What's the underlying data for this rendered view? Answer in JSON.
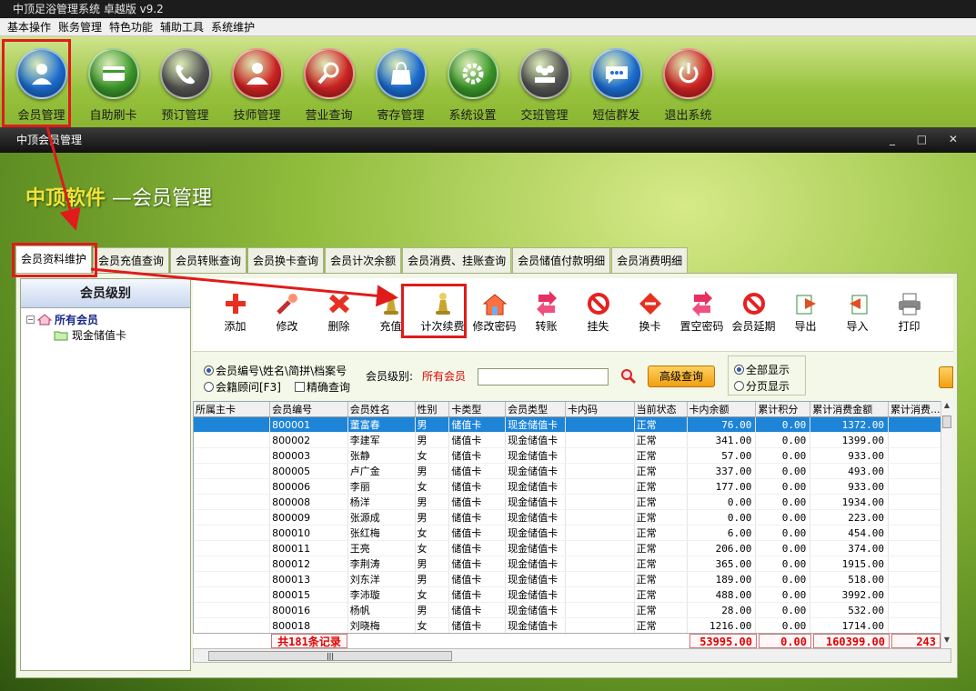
{
  "window": {
    "title": "中顶足浴管理系统 卓越版 v9.2"
  },
  "menu": [
    "基本操作",
    "账务管理",
    "特色功能",
    "辅助工具",
    "系统维护"
  ],
  "toolbar": [
    {
      "label": "会员管理",
      "icon": "user-icon",
      "color": "#1d6fd6"
    },
    {
      "label": "自助刷卡",
      "icon": "card-icon",
      "color": "#3c9a2b"
    },
    {
      "label": "预订管理",
      "icon": "phone-icon",
      "color": "#555555"
    },
    {
      "label": "技师管理",
      "icon": "worker-icon",
      "color": "#d22424"
    },
    {
      "label": "营业查询",
      "icon": "magnifier-icon",
      "color": "#d22424"
    },
    {
      "label": "寄存管理",
      "icon": "bag-icon",
      "color": "#1d6fd6"
    },
    {
      "label": "系统设置",
      "icon": "gear-icon",
      "color": "#3c9a2b"
    },
    {
      "label": "交班管理",
      "icon": "group-icon",
      "color": "#555555"
    },
    {
      "label": "短信群发",
      "icon": "message-icon",
      "color": "#1d6fd6"
    },
    {
      "label": "退出系统",
      "icon": "power-icon",
      "color": "#d22424"
    }
  ],
  "subwindow": {
    "title": "中顶会员管理",
    "controls": "_ □ ✕"
  },
  "brand": {
    "yellow": "中顶软件",
    "white": "—会员管理"
  },
  "tabs": [
    "会员资料维护",
    "会员充值查询",
    "会员转账查询",
    "会员换卡查询",
    "会员计次余额",
    "会员消费、挂账查询",
    "会员储值付款明细",
    "会员消费明细"
  ],
  "left": {
    "header": "会员级别",
    "root": "所有会员",
    "child": "现金储值卡"
  },
  "actions": [
    {
      "label": "添加",
      "icon": "plus-icon"
    },
    {
      "label": "修改",
      "icon": "wrench-icon"
    },
    {
      "label": "删除",
      "icon": "delete-icon"
    },
    {
      "label": "充值",
      "icon": "pawn-icon"
    },
    {
      "label": "计次续费",
      "icon": "pawn-icon"
    },
    {
      "label": "修改密码",
      "icon": "house-icon"
    },
    {
      "label": "转账",
      "icon": "transfer-icon"
    },
    {
      "label": "挂失",
      "icon": "forbid-icon"
    },
    {
      "label": "换卡",
      "icon": "swap-icon"
    },
    {
      "label": "置空密码",
      "icon": "transfer-icon"
    },
    {
      "label": "会员延期",
      "icon": "forbid-icon"
    },
    {
      "label": "导出",
      "icon": "export-icon"
    },
    {
      "label": "导入",
      "icon": "import-icon"
    },
    {
      "label": "打印",
      "icon": "printer-icon"
    }
  ],
  "search": {
    "opt1": "会员编号\\姓名\\简拼\\档案号",
    "opt2": "会籍顾问[F3]",
    "exact": "精确查询",
    "level_label": "会员级别:",
    "level_value": "所有会员",
    "advanced": "高级查询",
    "show_all": "全部显示",
    "paged": "分页显示"
  },
  "grid": {
    "columns": [
      "所属主卡",
      "会员编号",
      "会员姓名",
      "性别",
      "卡类型",
      "会员类型",
      "卡内码",
      "当前状态",
      "卡内余额",
      "累计积分",
      "累计消费金额",
      "累计消费..."
    ],
    "rows": [
      [
        "",
        "800001",
        "董富春",
        "男",
        "储值卡",
        "现金储值卡",
        "",
        "正常",
        "76.00",
        "0.00",
        "1372.00",
        ""
      ],
      [
        "",
        "800002",
        "李建军",
        "男",
        "储值卡",
        "现金储值卡",
        "",
        "正常",
        "341.00",
        "0.00",
        "1399.00",
        ""
      ],
      [
        "",
        "800003",
        "张静",
        "女",
        "储值卡",
        "现金储值卡",
        "",
        "正常",
        "57.00",
        "0.00",
        "933.00",
        ""
      ],
      [
        "",
        "800005",
        "卢广金",
        "男",
        "储值卡",
        "现金储值卡",
        "",
        "正常",
        "337.00",
        "0.00",
        "493.00",
        ""
      ],
      [
        "",
        "800006",
        "李丽",
        "女",
        "储值卡",
        "现金储值卡",
        "",
        "正常",
        "177.00",
        "0.00",
        "933.00",
        ""
      ],
      [
        "",
        "800008",
        "杨洋",
        "男",
        "储值卡",
        "现金储值卡",
        "",
        "正常",
        "0.00",
        "0.00",
        "1934.00",
        ""
      ],
      [
        "",
        "800009",
        "张源成",
        "男",
        "储值卡",
        "现金储值卡",
        "",
        "正常",
        "0.00",
        "0.00",
        "223.00",
        ""
      ],
      [
        "",
        "800010",
        "张红梅",
        "女",
        "储值卡",
        "现金储值卡",
        "",
        "正常",
        "6.00",
        "0.00",
        "454.00",
        ""
      ],
      [
        "",
        "800011",
        "王亮",
        "女",
        "储值卡",
        "现金储值卡",
        "",
        "正常",
        "206.00",
        "0.00",
        "374.00",
        ""
      ],
      [
        "",
        "800012",
        "李荆涛",
        "男",
        "储值卡",
        "现金储值卡",
        "",
        "正常",
        "365.00",
        "0.00",
        "1915.00",
        ""
      ],
      [
        "",
        "800013",
        "刘东洋",
        "男",
        "储值卡",
        "现金储值卡",
        "",
        "正常",
        "189.00",
        "0.00",
        "518.00",
        ""
      ],
      [
        "",
        "800015",
        "李沛璇",
        "女",
        "储值卡",
        "现金储值卡",
        "",
        "正常",
        "488.00",
        "0.00",
        "3992.00",
        ""
      ],
      [
        "",
        "800016",
        "杨帆",
        "男",
        "储值卡",
        "现金储值卡",
        "",
        "正常",
        "28.00",
        "0.00",
        "532.00",
        ""
      ],
      [
        "",
        "800018",
        "刘晓梅",
        "女",
        "储值卡",
        "现金储值卡",
        "",
        "正常",
        "1216.00",
        "0.00",
        "1714.00",
        ""
      ]
    ],
    "summary": {
      "count": "共181条记录",
      "balance": "53995.00",
      "points": "0.00",
      "spend": "160399.00",
      "more": "243"
    }
  }
}
